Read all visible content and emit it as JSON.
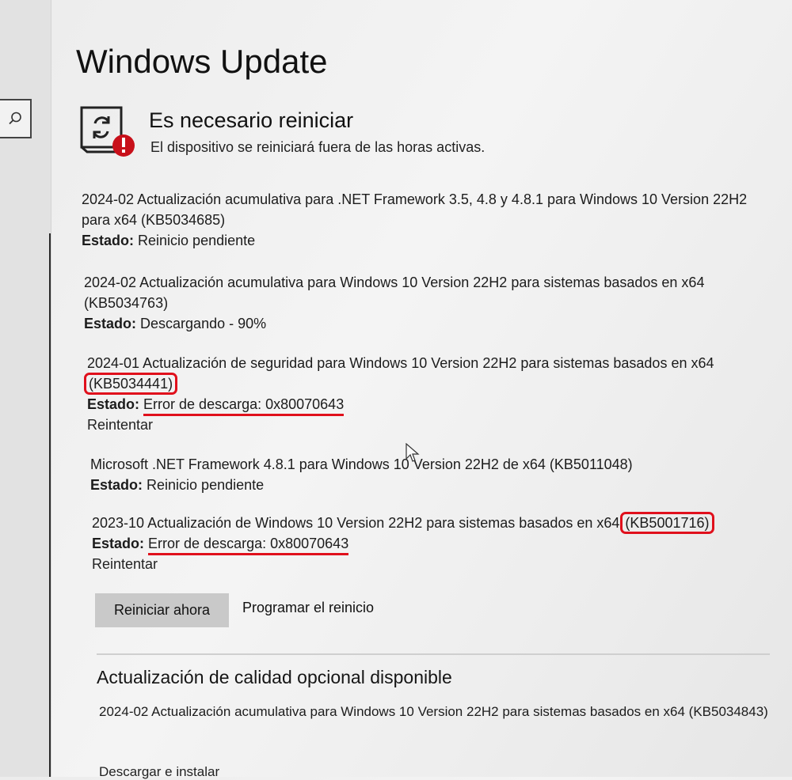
{
  "page": {
    "title": "Windows Update"
  },
  "status": {
    "heading": "Es necesario reiniciar",
    "message": "El dispositivo se reiniciará fuera de las horas activas.",
    "icon": "restart-required-icon"
  },
  "updates": [
    {
      "name": "2024-02 Actualización acumulativa para .NET Framework 3.5, 4.8 y 4.8.1 para Windows 10 Version 22H2 para x64 (KB5034685)",
      "state_label": "Estado:",
      "state_value": "Reinicio pendiente"
    },
    {
      "name": "2024-02 Actualización acumulativa para Windows 10 Version 22H2 para sistemas basados en x64 (KB5034763)",
      "state_label": "Estado:",
      "state_value": "Descargando - 90%"
    },
    {
      "name_prefix": "2024-01 Actualización de seguridad para Windows 10 Version 22H2 para sistemas basados en x64",
      "kb": "(KB5034441)",
      "state_label": "Estado:",
      "state_value": "Error de descarga: 0x80070643",
      "retry": "Reintentar"
    },
    {
      "name": "Microsoft .NET Framework 4.8.1 para Windows 10 Version 22H2 de x64 (KB5011048)",
      "state_label": "Estado:",
      "state_value": "Reinicio pendiente"
    },
    {
      "name_prefix": "2023-10 Actualización de Windows 10 Version 22H2 para sistemas basados en x64",
      "kb": "(KB5001716)",
      "state_label": "Estado:",
      "state_value": "Error de descarga: 0x80070643",
      "retry": "Reintentar"
    }
  ],
  "actions": {
    "restart_now": "Reiniciar ahora",
    "schedule_restart": "Programar el reinicio"
  },
  "optional": {
    "title": "Actualización de calidad opcional disponible",
    "name": "2024-02 Actualización acumulativa para Windows 10 Version 22H2 para sistemas basados en x64 (KB5034843)",
    "action": "Descargar e instalar"
  },
  "colors": {
    "highlight": "#e0101c",
    "button": "#c9c9c9"
  }
}
